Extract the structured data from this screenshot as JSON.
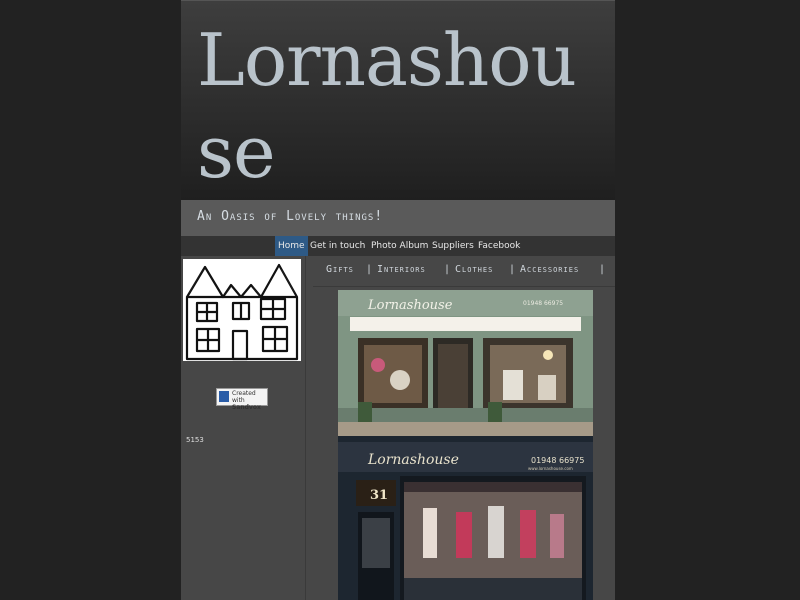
{
  "site": {
    "title": "Lornashouse",
    "tagline": "An Oasis of Lovely things!"
  },
  "nav": {
    "items": [
      {
        "label": "Home",
        "active": true
      },
      {
        "label": "Get in touch"
      },
      {
        "label": "Photo Album"
      },
      {
        "label": "Suppliers"
      },
      {
        "label": "Facebook"
      }
    ]
  },
  "categories": {
    "items": [
      "Gifts",
      "Interiors",
      "Clothes",
      "Accessories"
    ],
    "separator": "|"
  },
  "sidebar": {
    "badge_line1": "Created with",
    "badge_line2": "Sandvox",
    "counter": "5153"
  },
  "photo": {
    "shop_sign_top": "Lornashouse",
    "shop_phone_top": "01948 66975",
    "shop_sign_bottom": "Lornashouse",
    "shop_phone_bottom": "01948 66975",
    "shop_url": "www.lornashouse.com",
    "door_number": "31"
  },
  "colors": {
    "background": "#222222",
    "page": "#474747",
    "nav_active": "#2e5a86",
    "title": "#b9c3cb"
  }
}
